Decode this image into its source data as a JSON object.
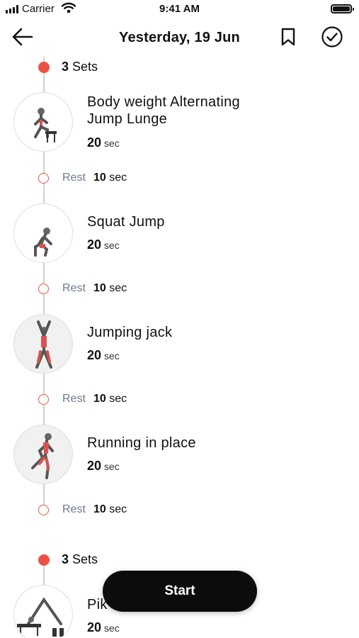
{
  "status": {
    "carrier": "Carrier",
    "time": "9:41 AM"
  },
  "nav": {
    "title": "Yesterday, 19 Jun"
  },
  "sets": [
    {
      "count": "3",
      "label": "Sets"
    },
    {
      "count": "3",
      "label": "Sets"
    }
  ],
  "exercises": [
    {
      "name_line1": "Body weight Alternating",
      "name_line2": "Jump Lunge",
      "duration": "20",
      "unit": "sec"
    },
    {
      "name_line1": "Squat Jump",
      "duration": "20",
      "unit": "sec"
    },
    {
      "name_line1": "Jumping jack",
      "duration": "20",
      "unit": "sec"
    },
    {
      "name_line1": "Running in place",
      "duration": "20",
      "unit": "sec"
    },
    {
      "name_line1": "Pik",
      "duration": "20",
      "unit": "sec"
    }
  ],
  "rests": [
    {
      "label": "Rest",
      "value": "10",
      "unit": "sec"
    },
    {
      "label": "Rest",
      "value": "10",
      "unit": "sec"
    },
    {
      "label": "Rest",
      "value": "10",
      "unit": "sec"
    },
    {
      "label": "Rest",
      "value": "10",
      "unit": "sec"
    }
  ],
  "start_label": "Start",
  "colors": {
    "accent": "#ec5244",
    "rest_text": "#6b7a8f",
    "button": "#0c0c0c"
  },
  "icons": [
    "back-arrow-icon",
    "bookmark-icon",
    "check-circle-icon",
    "signal-icon",
    "wifi-icon",
    "battery-icon"
  ]
}
